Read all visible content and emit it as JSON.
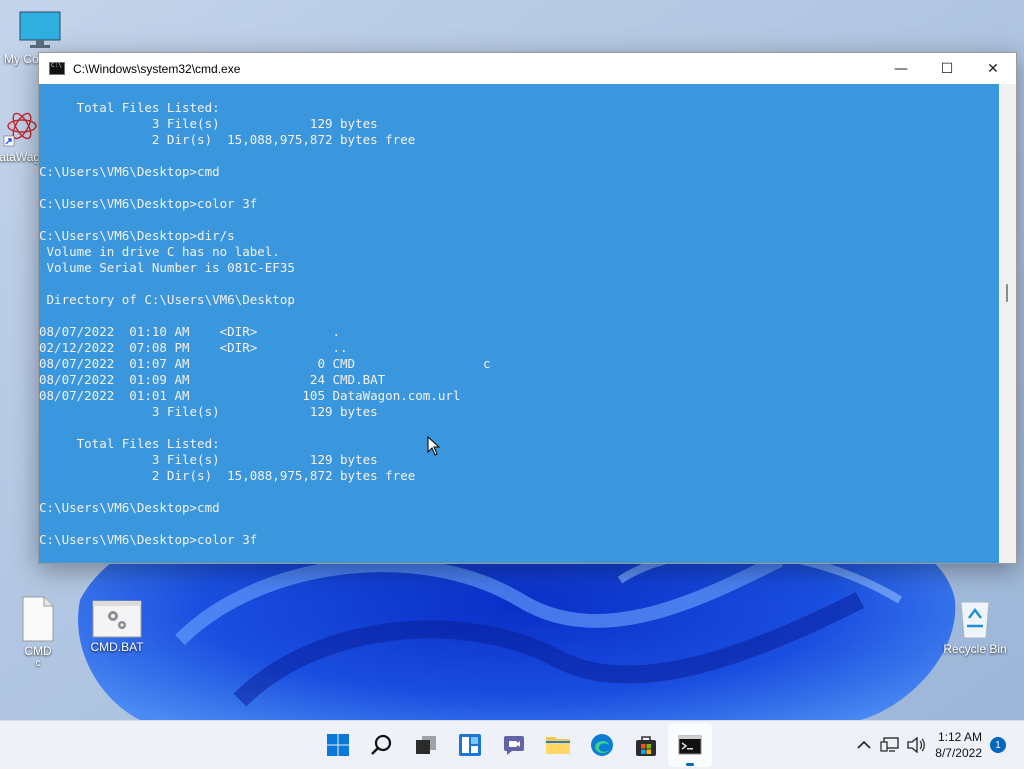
{
  "desktop": {
    "icons": {
      "my_computer": "My Computer",
      "datawagon": "DataWagon",
      "cmd_file": "CMD",
      "cmd_file_sub": "c",
      "cmd_bat": "CMD.BAT",
      "recycle_bin": "Recycle Bin"
    }
  },
  "window": {
    "title": "C:\\Windows\\system32\\cmd.exe",
    "minimize_glyph": "—",
    "maximize_glyph": "☐",
    "close_glyph": "✕"
  },
  "console": {
    "background_color": "#3a96dd",
    "text_color": "#f2f2f2",
    "lines": [
      "",
      "     Total Files Listed:",
      "               3 File(s)            129 bytes",
      "               2 Dir(s)  15,088,975,872 bytes free",
      "",
      "C:\\Users\\VM6\\Desktop>cmd",
      "",
      "C:\\Users\\VM6\\Desktop>color 3f",
      "",
      "C:\\Users\\VM6\\Desktop>dir/s",
      " Volume in drive C has no label.",
      " Volume Serial Number is 081C-EF35",
      "",
      " Directory of C:\\Users\\VM6\\Desktop",
      "",
      "08/07/2022  01:10 AM    <DIR>          .",
      "02/12/2022  07:08 PM    <DIR>          ..",
      "08/07/2022  01:07 AM                 0 CMD                 c",
      "08/07/2022  01:09 AM                24 CMD.BAT",
      "08/07/2022  01:01 AM               105 DataWagon.com.url",
      "               3 File(s)            129 bytes",
      "",
      "     Total Files Listed:",
      "               3 File(s)            129 bytes",
      "               2 Dir(s)  15,088,975,872 bytes free",
      "",
      "C:\\Users\\VM6\\Desktop>cmd",
      "",
      "C:\\Users\\VM6\\Desktop>color 3f"
    ]
  },
  "taskbar": {
    "apps": [
      "start-icon",
      "search-icon",
      "task-view-icon",
      "widgets-icon",
      "chat-icon",
      "file-explorer-icon",
      "edge-icon",
      "store-icon",
      "terminal-icon"
    ],
    "accent_color": "#0067c0",
    "tray": {
      "chevron": "^",
      "time": "1:12 AM",
      "date": "8/7/2022",
      "notification_count": "1"
    }
  }
}
